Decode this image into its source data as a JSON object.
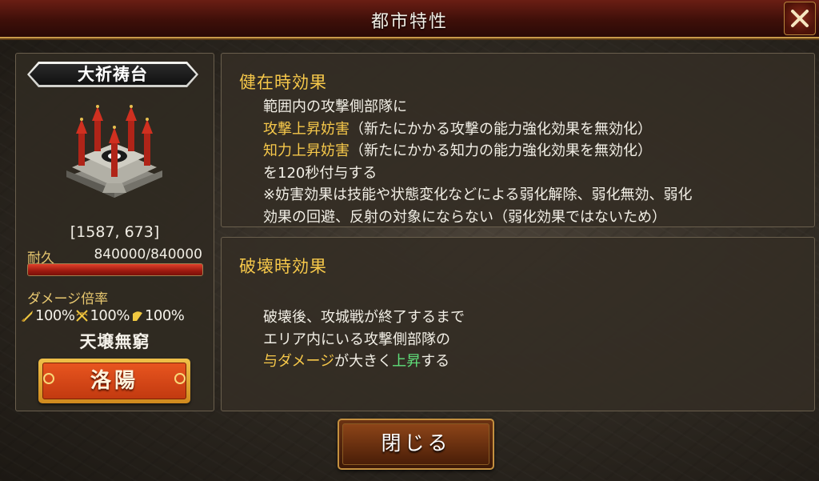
{
  "header": {
    "title": "都市特性"
  },
  "icons": {
    "close": "close-x-icon",
    "building": "altar-building-icon",
    "attack": "sword-icon",
    "crossbow": "bow-icon",
    "intel": "fan-icon"
  },
  "colors": {
    "accent_gold": "#f6c84a",
    "accent_green": "#5fe07a",
    "title_red": "#6a1e14"
  },
  "left_panel": {
    "building_name": "大祈祷台",
    "coords": "[1587, 673]",
    "durability_label": "耐久",
    "durability_value": "840000/840000",
    "durability_fraction": 1.0,
    "damage_label": "ダメージ倍率",
    "damage_multipliers": [
      "100%",
      "100%",
      "100%"
    ],
    "status": "天壌無窮",
    "city_button": "洛陽"
  },
  "effects": {
    "intact": {
      "heading": "健在時効果",
      "line1": "範囲内の攻撃側部隊に",
      "line2_hl": "攻撃上昇妨害",
      "line2_rest": "（新たにかかる攻撃の能力強化効果を無効化）",
      "line3_hl": "知力上昇妨害",
      "line3_rest": "（新たにかかる知力の能力強化効果を無効化）",
      "line4": "を120秒付与する",
      "line5": "※妨害効果は技能や状態変化などによる弱化解除、弱化無効、弱化",
      "line6": "効果の回避、反射の対象にならない（弱化効果ではないため）"
    },
    "destroyed": {
      "heading": "破壊時効果",
      "line1": "破壊後、攻城戦が終了するまで",
      "line2": "エリア内にいる攻撃側部隊の",
      "line3_hl": "与ダメージ",
      "line3_mid": "が大きく",
      "line3_hl2": "上昇",
      "line3_end": "する"
    }
  },
  "footer": {
    "close_label": "閉じる"
  }
}
